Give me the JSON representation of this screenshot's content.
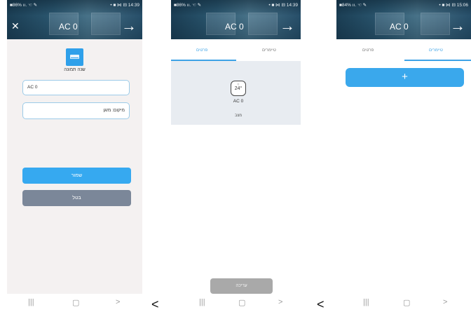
{
  "screens": [
    {
      "status": {
        "left": "■86% ıı. ☜ ✎",
        "right": "• ■ ⋈ ⊟ 14:39"
      },
      "title": "AC 0",
      "form": {
        "change_image_label": "שנה תמונה",
        "name_value": "AC 0",
        "location_value": "מיקום: מזגן",
        "save_label": "שמור",
        "cancel_label": "בטל"
      },
      "nav": {
        "recent": "|||",
        "home": "▢",
        "back": ">"
      }
    },
    {
      "status": {
        "left": "■86% ıı. ☜ ✎",
        "right": "• ■ ⋈ ⊟ 14:39"
      },
      "title": "AC 0",
      "tabs": {
        "left": "פרטים",
        "right": "טיימרים"
      },
      "device": {
        "temperature": "24°",
        "name": "AC 0",
        "status": "מצב"
      },
      "edit_label": "עריכה",
      "nav": {
        "recent": "|||",
        "home": "▢",
        "back": ">"
      }
    },
    {
      "status": {
        "left": "■84% ıı. ☜ ✎",
        "right": "• ■ ⋈ ⊟ 15:06"
      },
      "title": "AC 0",
      "tabs": {
        "left": "פרטים",
        "right": "טיימרים"
      },
      "add_label": "+",
      "nav": {
        "recent": "|||",
        "home": "▢",
        "back": ">"
      }
    }
  ],
  "separators": [
    "<",
    "<"
  ],
  "colors": {
    "accent": "#3aa8ec",
    "cancel": "#7b8799",
    "edit": "#a9a9a9"
  }
}
